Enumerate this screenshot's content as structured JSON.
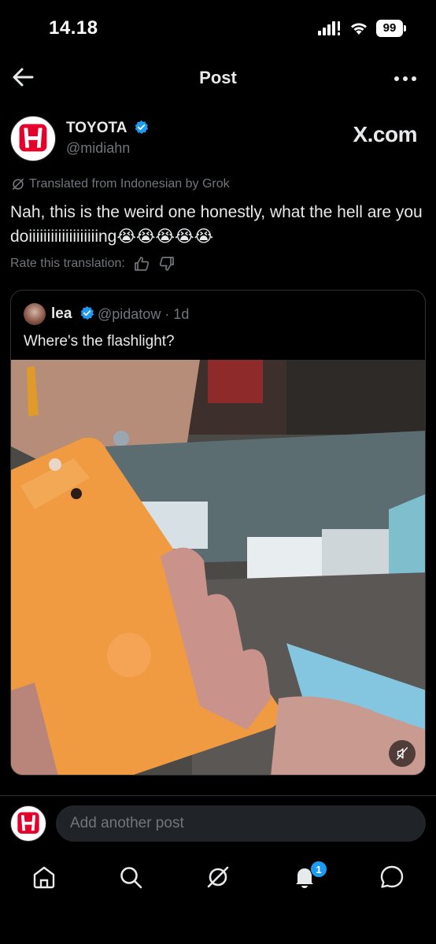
{
  "status_bar": {
    "time": "14.18",
    "battery": "99"
  },
  "header": {
    "title": "Post"
  },
  "post": {
    "author_name": "TOYOTA",
    "author_handle": "@midiahn",
    "watermark": "X.com",
    "translated_label": "Translated from Indonesian by Grok",
    "text": "Nah, this is the weird one honestly, what the hell are you doiiiiiiiiiiiiiiiiiiing😭😭😭😭😭",
    "rate_label": "Rate this translation:"
  },
  "quote": {
    "author_name": "lea",
    "author_handle": "@pidatow · 1d",
    "text": "Where's the flashlight?"
  },
  "reply": {
    "placeholder": "Add another post"
  },
  "nav": {
    "items": [
      {
        "icon": "home-icon"
      },
      {
        "icon": "search-icon"
      },
      {
        "icon": "grok-icon"
      },
      {
        "icon": "notifications-icon"
      },
      {
        "icon": "messages-icon"
      }
    ],
    "notification_count": "1"
  },
  "colors": {
    "background": "#000000",
    "text_primary": "#e7e9ea",
    "text_secondary": "#71767b",
    "accent": "#1d9bf0",
    "honda_red": "#e4002b"
  }
}
